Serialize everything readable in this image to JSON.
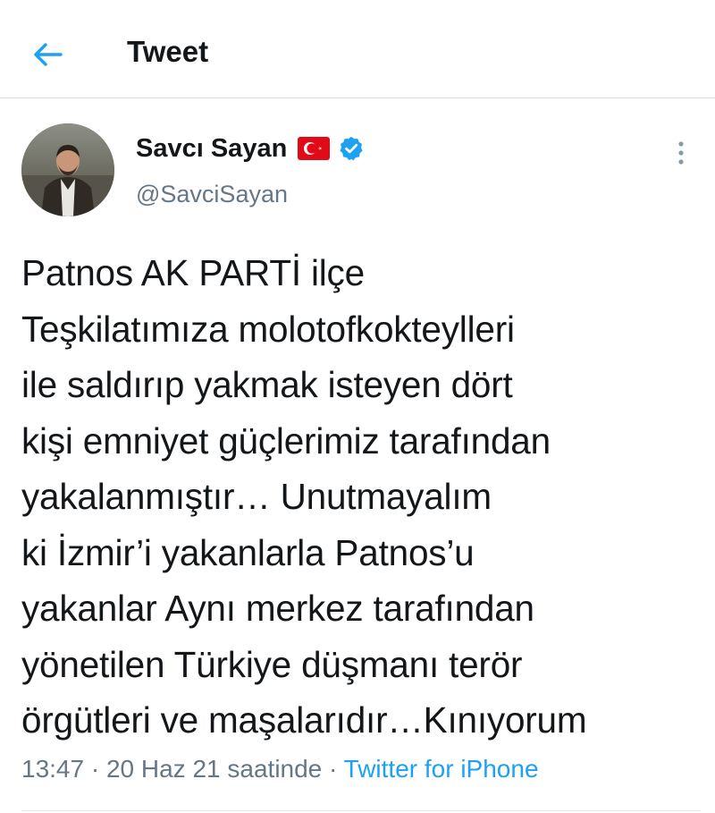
{
  "header": {
    "title": "Tweet",
    "back_icon": "arrow-left-icon",
    "accent_color": "#1da1f2"
  },
  "tweet": {
    "author": {
      "display_name": "Savcı Sayan",
      "handle": "@SavciSayan",
      "flag_icon": "turkey-flag-icon",
      "verified_icon": "verified-badge-icon",
      "verified_color": "#1da1f2"
    },
    "more_icon": "more-vertical-icon",
    "text": "Patnos AK PARTİ ilçe\nTeşkilatımıza molotofkokteylleri\nile saldırıp yakmak isteyen dört\nkişi emniyet güçlerimiz tarafından\nyakalanmıştır… Unutmayalım\nki İzmir’i yakanlarla Patnos’u\nyakanlar Aynı merkez tarafından\nyönetilen Türkiye düşmanı terör\nörgütleri ve maşalarıdır…Kınıyorum",
    "time": "13:47",
    "separator": " · ",
    "date": "20 Haz 21 saatinde",
    "source": "Twitter for iPhone"
  }
}
